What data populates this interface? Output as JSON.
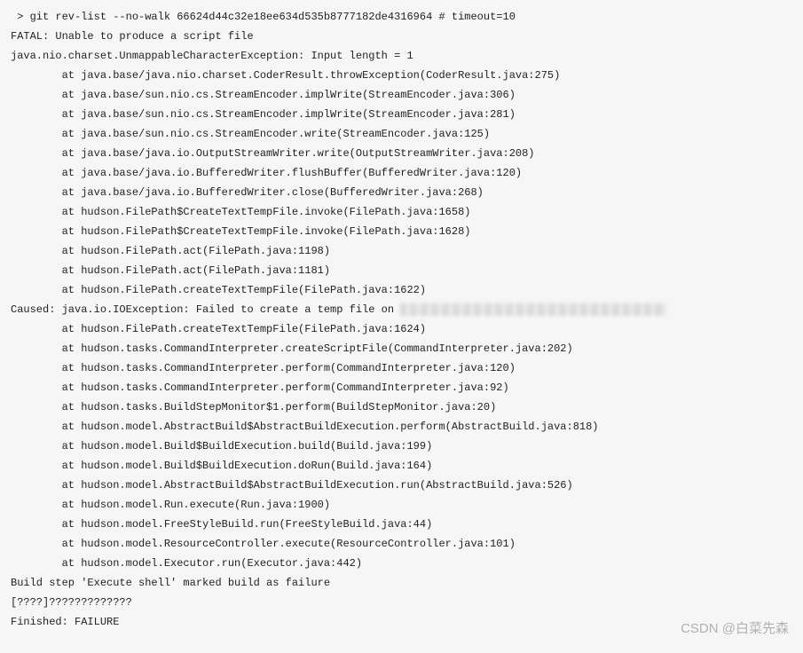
{
  "log": {
    "lines": [
      " > git rev-list --no-walk 66624d44c32e18ee634d535b8777182de4316964 # timeout=10",
      "FATAL: Unable to produce a script file",
      "java.nio.charset.UnmappableCharacterException: Input length = 1",
      "        at java.base/java.nio.charset.CoderResult.throwException(CoderResult.java:275)",
      "        at java.base/sun.nio.cs.StreamEncoder.implWrite(StreamEncoder.java:306)",
      "        at java.base/sun.nio.cs.StreamEncoder.implWrite(StreamEncoder.java:281)",
      "        at java.base/sun.nio.cs.StreamEncoder.write(StreamEncoder.java:125)",
      "        at java.base/java.io.OutputStreamWriter.write(OutputStreamWriter.java:208)",
      "        at java.base/java.io.BufferedWriter.flushBuffer(BufferedWriter.java:120)",
      "        at java.base/java.io.BufferedWriter.close(BufferedWriter.java:268)",
      "        at hudson.FilePath$CreateTextTempFile.invoke(FilePath.java:1658)",
      "        at hudson.FilePath$CreateTextTempFile.invoke(FilePath.java:1628)",
      "        at hudson.FilePath.act(FilePath.java:1198)",
      "        at hudson.FilePath.act(FilePath.java:1181)",
      "        at hudson.FilePath.createTextTempFile(FilePath.java:1622)",
      "Caused: java.io.IOException: Failed to create a temp file on ",
      "        at hudson.FilePath.createTextTempFile(FilePath.java:1624)",
      "        at hudson.tasks.CommandInterpreter.createScriptFile(CommandInterpreter.java:202)",
      "        at hudson.tasks.CommandInterpreter.perform(CommandInterpreter.java:120)",
      "        at hudson.tasks.CommandInterpreter.perform(CommandInterpreter.java:92)",
      "        at hudson.tasks.BuildStepMonitor$1.perform(BuildStepMonitor.java:20)",
      "        at hudson.model.AbstractBuild$AbstractBuildExecution.perform(AbstractBuild.java:818)",
      "        at hudson.model.Build$BuildExecution.build(Build.java:199)",
      "        at hudson.model.Build$BuildExecution.doRun(Build.java:164)",
      "        at hudson.model.AbstractBuild$AbstractBuildExecution.run(AbstractBuild.java:526)",
      "        at hudson.model.Run.execute(Run.java:1900)",
      "        at hudson.model.FreeStyleBuild.run(FreeStyleBuild.java:44)",
      "        at hudson.model.ResourceController.execute(ResourceController.java:101)",
      "        at hudson.model.Executor.run(Executor.java:442)",
      "Build step 'Execute shell' marked build as failure",
      "",
      "[????]?????????????",
      "Finished: FAILURE"
    ]
  },
  "watermark": "CSDN @白菜先森"
}
